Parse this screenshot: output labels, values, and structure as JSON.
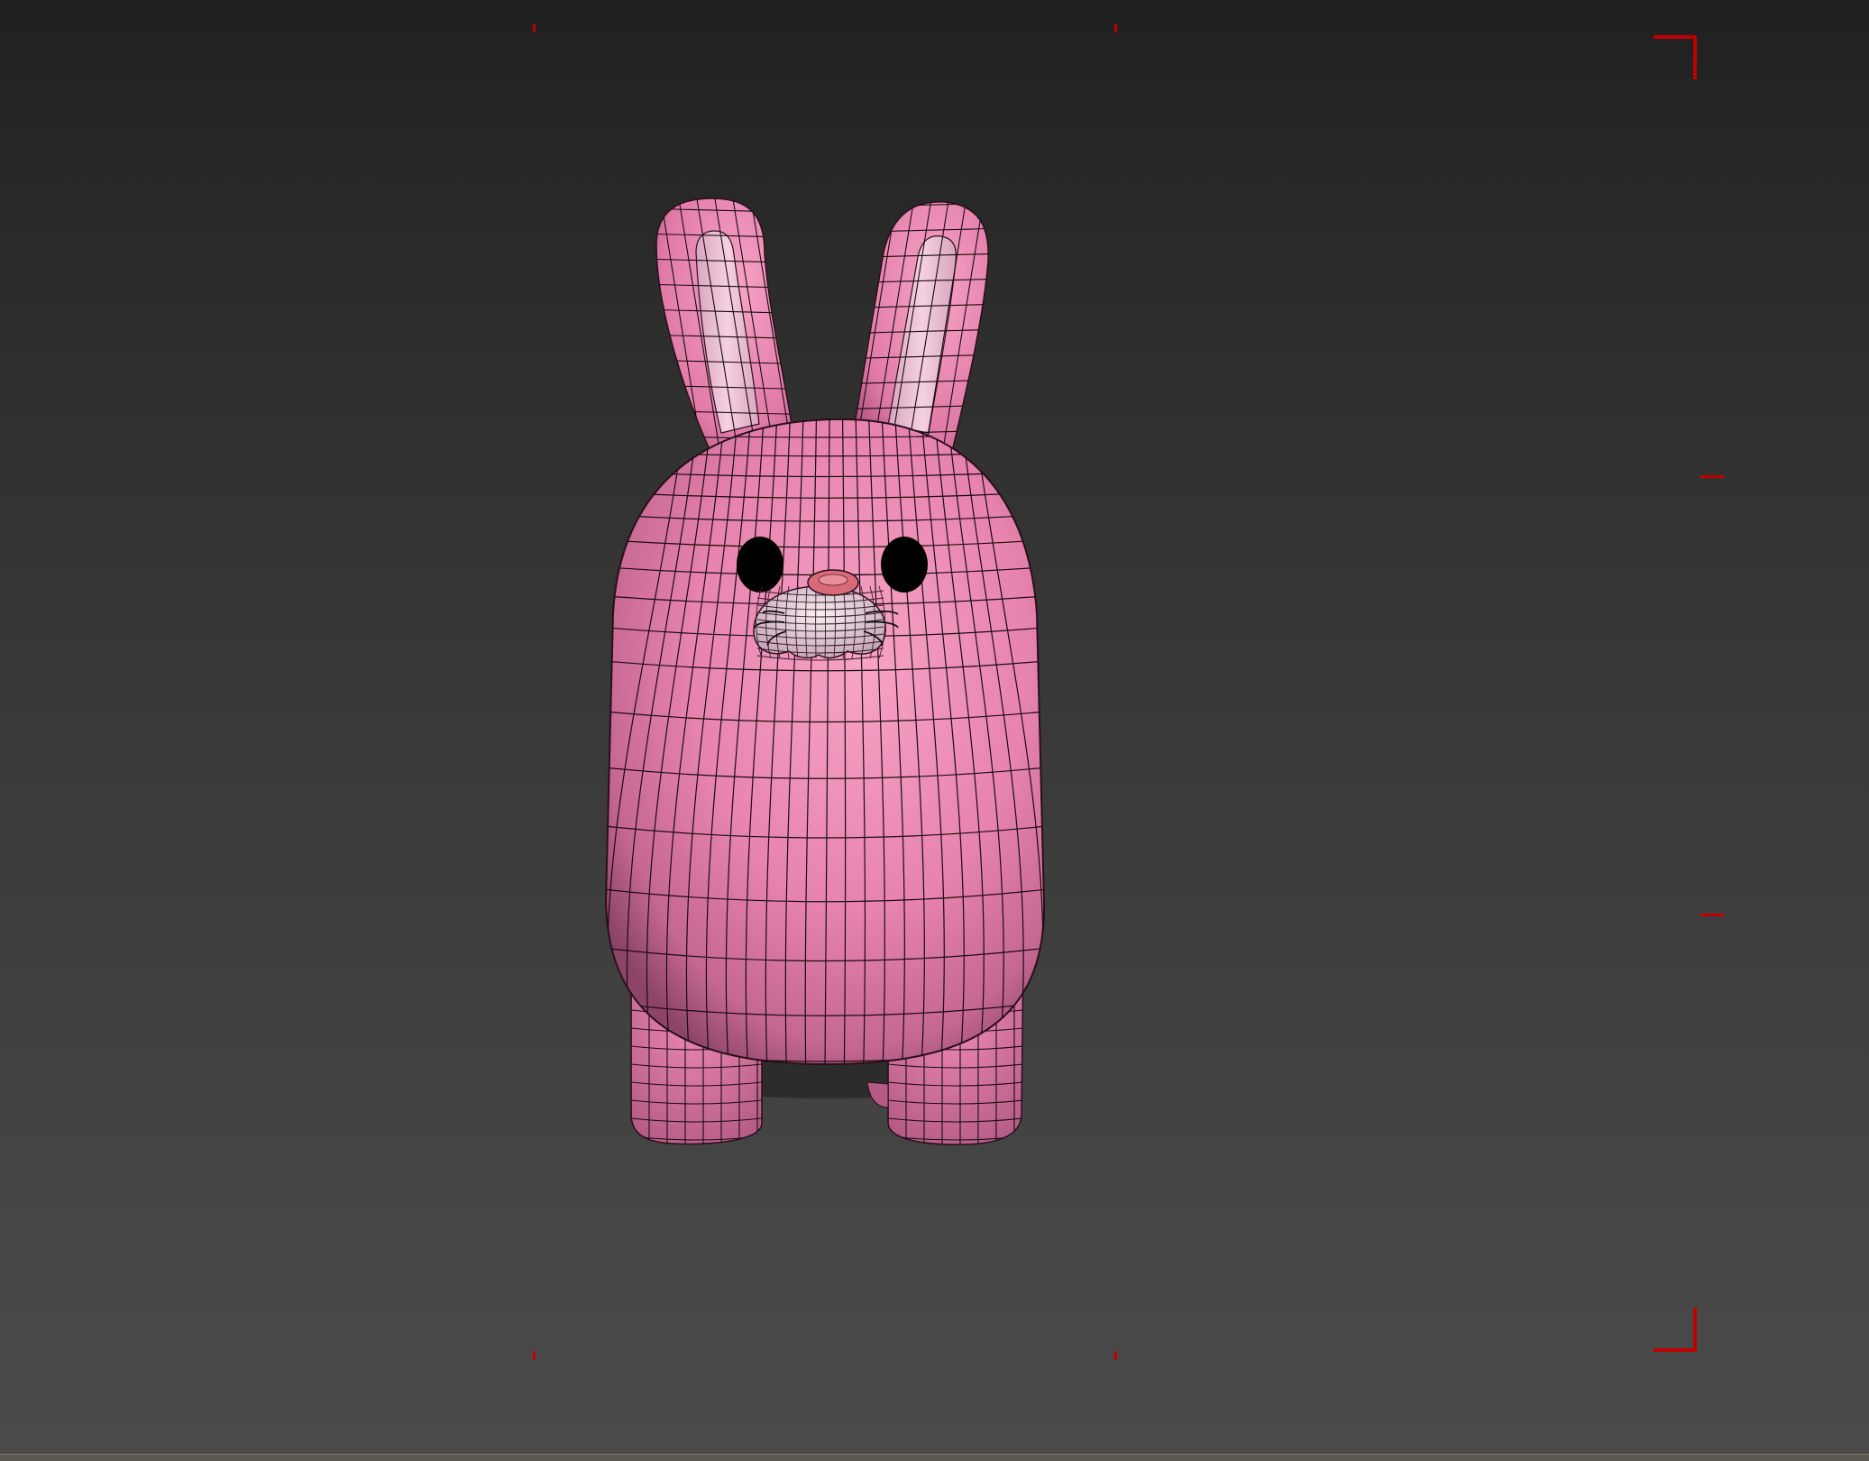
{
  "viewport": {
    "label": "",
    "background": "#3b3b3b",
    "safe_frame_color": "#c00000"
  },
  "model": {
    "subject": "bunny",
    "body_color": "#f08cb4",
    "inner_ear_color": "#f2c4d8",
    "nose_color": "#d86a78",
    "muzzle_color": "#efe4ea",
    "eye_color": "#000000",
    "wireframe_color": "#1a0a10",
    "wireframe_visible": true
  }
}
